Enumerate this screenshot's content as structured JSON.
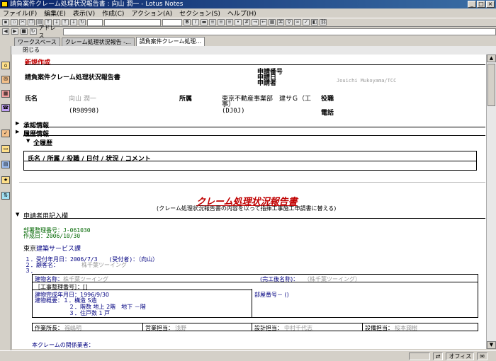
{
  "window": {
    "title": "請負案件クレーム処理状況報告書 : 向山 潤一 - Lotus Notes"
  },
  "menu": [
    "ファイル(F)",
    "編集(E)",
    "表示(V)",
    "作成(C)",
    "アクション(A)",
    "セクション(S)",
    "ヘルプ(H)"
  ],
  "toolbar": {
    "address_label": "アドレス",
    "bold_label": "B",
    "italic_label": "I"
  },
  "tabs": [
    "ワークスペース",
    "クレーム処理状況報告 -...",
    "請負案件クレーム処理..."
  ],
  "actionbar": {
    "close_label": "閉じる"
  },
  "form": {
    "status": "新規作成",
    "title": "請負案件クレーム処理状況報告書",
    "app_no_label": "申請番号",
    "app_date_label": "申請日",
    "applicant_label": "申請者",
    "applicant_value": "Jouichi Mukoyama/TCC",
    "name_label": "氏名",
    "name_value": "向山 潤一",
    "emp_no": "(R98998)",
    "dept_label": "所属",
    "dept_value_1": "東京不動産事業部　建サＧ（工",
    "dept_value_2": "事）",
    "dept_code": "(DJ0J)",
    "role_label": "役職",
    "phone_label": "電話",
    "approval_section": "承認情報",
    "history_section": "履歴情報",
    "all_history": "全履歴",
    "history_header": "氏名 / 所属 / 役職 / 日付 / 状況 / コメント",
    "report_title": "クレーム処理状況報告書",
    "report_subtitle": "(クレーム処理状況報告書の内容を以って指揮工事施工申請書に替える)",
    "applicant_section": "申請者用記入欄",
    "dept_no_line": "部署整理番号：J-061030",
    "created_line": "作成日：2006/10/30",
    "tokyo_label": "東京",
    "service_label": "建築サービス課",
    "item1": "１．受付年月日：2006/7/3　　(受付者)：（向山）",
    "item2": "２．顧客名：",
    "item2_value": "株千葉ツーイング",
    "item3": "３．",
    "bldg_name_label": "建物名称：",
    "bldg_name_value": "株千葉ツーイング",
    "completion_label": "(完工後名称)：",
    "completion_value": "（株千葉ツーイング）",
    "work_no_label": "［工事整理番号］：[]",
    "room_no_label": "部屋番号－ ()",
    "bldg_done": "建物完成年月日：1996/9/30",
    "bldg_outline": "建物概要：１．構造 S造",
    "floors": "２．階数 地上 2階　地下 －階",
    "units": "３．住戸数 1 戸",
    "work_lead_label": "作業所長：",
    "work_lead_value": "福嶋明",
    "sales_label": "営業担当：",
    "sales_value": "浅野",
    "design_label": "設計担当：",
    "design_value": "中村千代志",
    "equip_label": "設備担当：",
    "equip_value": "桜本潤樹",
    "related_label": "本クレームの関係業者："
  },
  "statusbar": {
    "office": "オフィス"
  }
}
